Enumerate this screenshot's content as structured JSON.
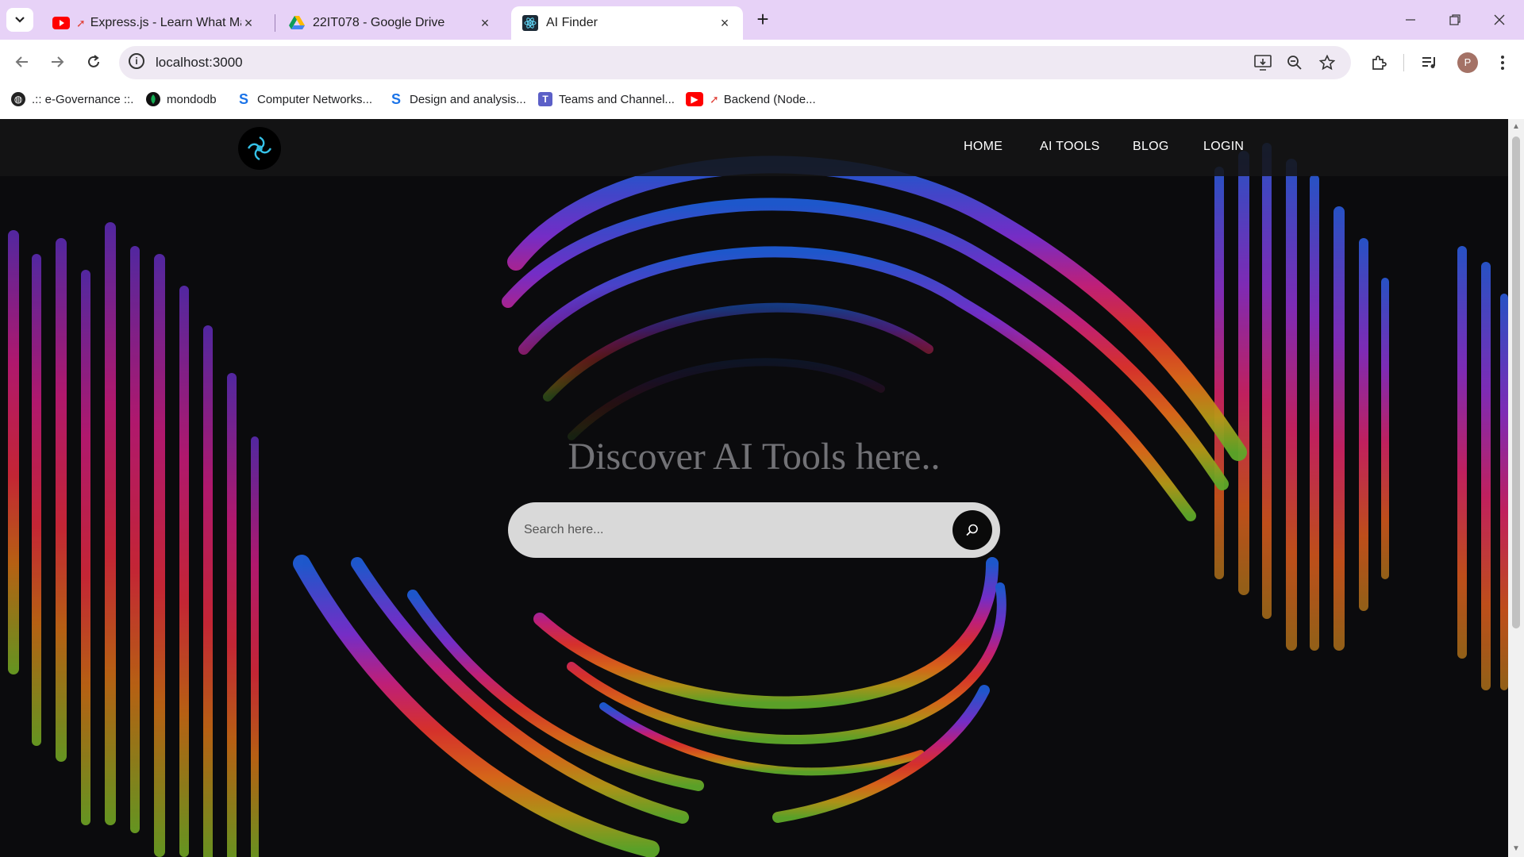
{
  "browser": {
    "tabs": [
      {
        "title": "Express.js - Learn What Mat",
        "icon": "youtube-icon"
      },
      {
        "title": "22IT078 - Google Drive",
        "icon": "google-drive-icon"
      },
      {
        "title": "AI Finder",
        "icon": "react-icon",
        "active": true
      }
    ],
    "url": "localhost:3000",
    "profile_initial": "P",
    "bookmarks": [
      {
        "label": ".:: e-Governance ::.",
        "icon": "globe-icon"
      },
      {
        "label": "mondodb",
        "icon": "mongodb-leaf-icon"
      },
      {
        "label": "Computer Networks...",
        "icon": "s-logo-icon"
      },
      {
        "label": "Design and analysis...",
        "icon": "s-logo-icon"
      },
      {
        "label": "Teams and Channel...",
        "icon": "teams-icon"
      },
      {
        "label": "Backend (Node...",
        "icon": "youtube-icon"
      }
    ]
  },
  "site": {
    "nav": {
      "home": "HOME",
      "ai_tools": "AI TOOLS",
      "blog": "BLOG",
      "login": "LOGIN"
    },
    "hero_title": "Discover AI Tools here..",
    "search": {
      "placeholder": "Search here..."
    }
  },
  "colors": {
    "tabbar": "#e7d2f7",
    "page_bg": "#0b0b0d",
    "logo_accent": "#35c2e8",
    "search_bg": "#d9d9d9"
  }
}
